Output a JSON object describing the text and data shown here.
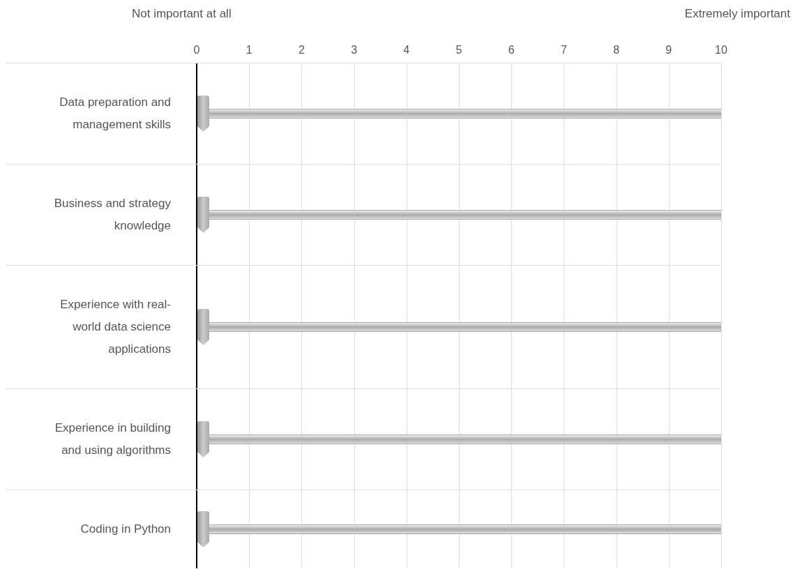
{
  "scale": {
    "min_label": "Not important at all",
    "max_label": "Extremely important",
    "ticks": [
      "0",
      "1",
      "2",
      "3",
      "4",
      "5",
      "6",
      "7",
      "8",
      "9",
      "10"
    ]
  },
  "items": [
    {
      "label": "Data preparation and management skills",
      "level": 0
    },
    {
      "label": "Business and strategy knowledge",
      "level": 0
    },
    {
      "label": "Experience with real-world data science applications",
      "level": 0
    },
    {
      "label": "Experience in building and using algorithms",
      "level": 0
    },
    {
      "label": "Coding in Python",
      "level": 0
    }
  ]
}
